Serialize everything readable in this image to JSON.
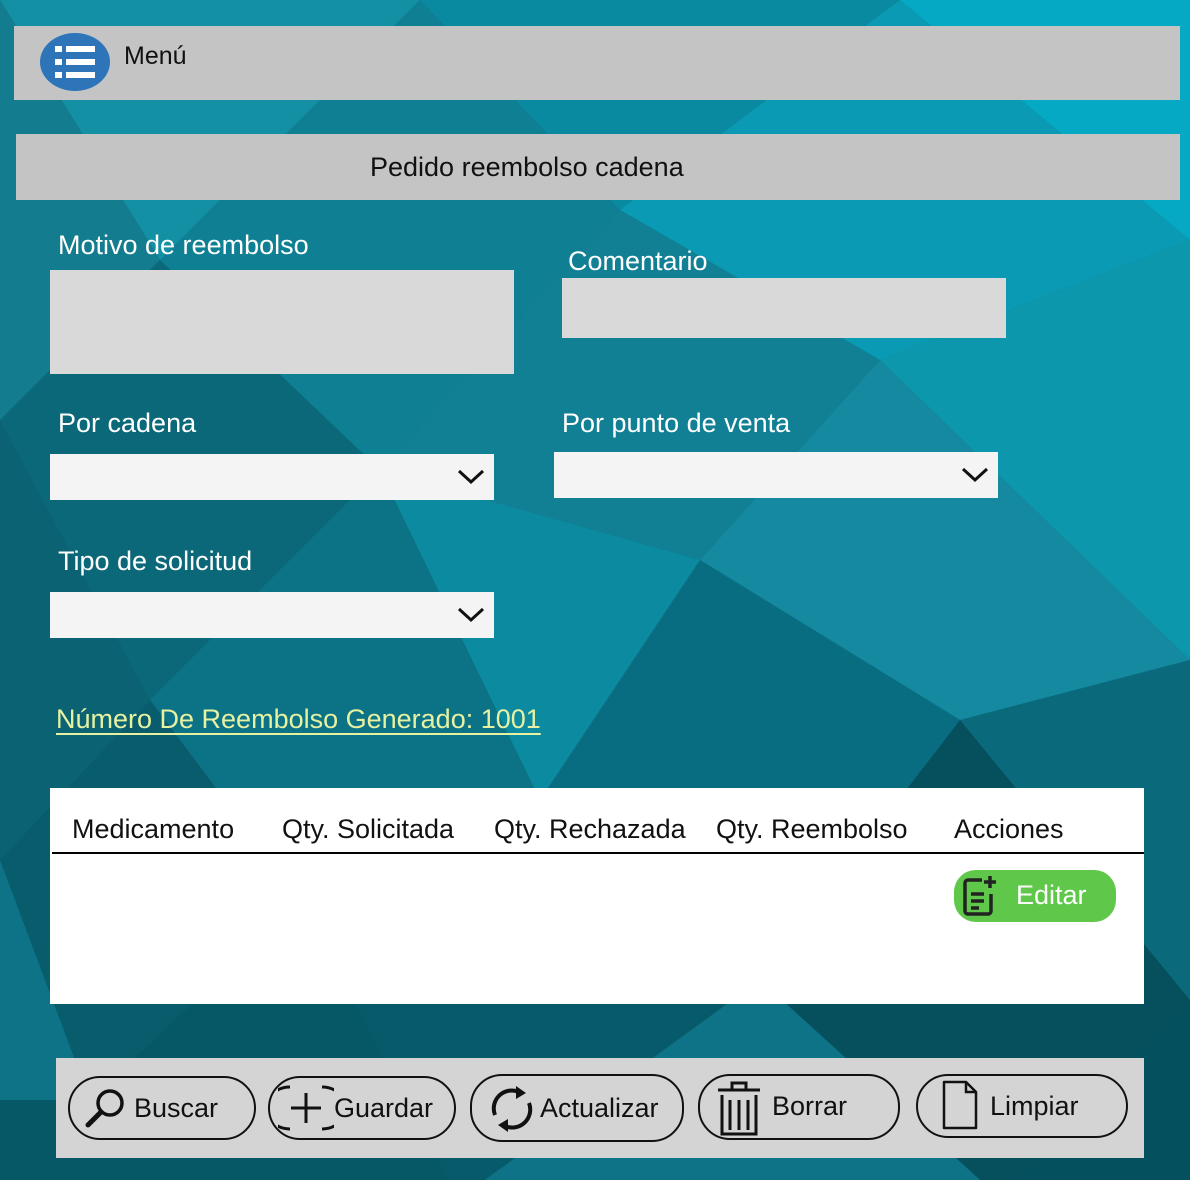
{
  "header": {
    "menu_label": "Menú"
  },
  "page": {
    "title": "Pedido reembolso cadena"
  },
  "form": {
    "motivo_label": "Motivo de reembolso",
    "motivo_value": "",
    "comentario_label": "Comentario",
    "comentario_value": "",
    "cadena_label": "Por cadena",
    "cadena_value": "",
    "punto_venta_label": "Por punto de venta",
    "punto_venta_value": "",
    "tipo_label": "Tipo de solicitud",
    "tipo_value": ""
  },
  "reembolso_link": "Número De Reembolso Generado: 1001",
  "table": {
    "columns": [
      "Medicamento",
      "Qty. Solicitada",
      "Qty. Rechazada",
      "Qty. Reembolso",
      "Acciones"
    ],
    "rows": [
      {
        "medicamento": "",
        "qty_solicitada": "",
        "qty_rechazada": "",
        "qty_reembolso": "",
        "action_label": "Editar"
      }
    ]
  },
  "actions": {
    "buscar": "Buscar",
    "guardar": "Guardar",
    "actualizar": "Actualizar",
    "borrar": "Borrar",
    "limpiar": "Limpiar"
  },
  "icons": {
    "menu": "list-icon",
    "dropdown": "chevron-down-icon",
    "edit": "note-add-icon",
    "buscar": "search-icon",
    "guardar": "plus-circle-icon",
    "actualizar": "refresh-icon",
    "borrar": "trash-icon",
    "limpiar": "document-icon"
  },
  "colors": {
    "background": "#0d6f84",
    "bar_gray": "#c4c4c4",
    "menu_button": "#2d74b8",
    "input_fill": "#d9d9d9",
    "select_fill": "#f4f4f4",
    "link": "#e7f1a2",
    "edit_button": "#5fc84a",
    "action_bar": "#d4d4d4"
  }
}
